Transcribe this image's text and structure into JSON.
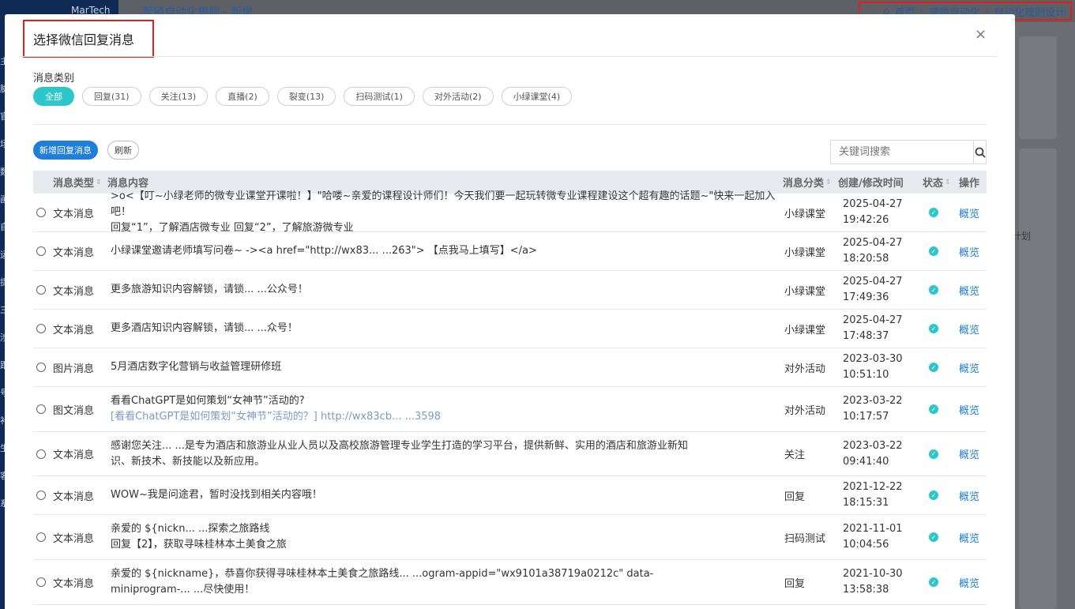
{
  "background": {
    "brand": "MarTech",
    "page_title": "营销自动化规则 - 新增",
    "breadcrumb": [
      "首页",
      "营销自动化",
      "自动化规则设计"
    ],
    "side_text": "计划",
    "left_glyphs": [
      "主",
      "臉",
      "官",
      "场",
      "数",
      "画",
      "自",
      "运",
      "提",
      "三",
      "渉",
      "跟",
      "号",
      "补",
      "生",
      "客",
      "系"
    ]
  },
  "modal": {
    "title": "选择微信回复消息",
    "close_label": "×",
    "category_label": "消息类别",
    "categories": [
      {
        "label": "全部",
        "active": true
      },
      {
        "label": "回复(31)",
        "active": false
      },
      {
        "label": "关注(13)",
        "active": false
      },
      {
        "label": "直播(2)",
        "active": false
      },
      {
        "label": "裂变(13)",
        "active": false
      },
      {
        "label": "扫码测试(1)",
        "active": false
      },
      {
        "label": "对外活动(2)",
        "active": false
      },
      {
        "label": "小绿课堂(4)",
        "active": false
      }
    ],
    "toolbar": {
      "add_label": "新增回复消息",
      "refresh_label": "刷新"
    },
    "search": {
      "placeholder": "关键词搜索",
      "value": ""
    },
    "table": {
      "headers": {
        "type": "消息类型",
        "content": "消息内容",
        "category": "消息分类",
        "time": "创建/修改时间",
        "status": "状态",
        "op": "操作"
      },
      "rows": [
        {
          "type": "文本消息",
          "line1": ">o<【叮~小绿老师的微专业课堂开课啦！】\"哈喽~亲爱的课程设计师们！今天我们要一起玩转微专业课程建设这个超有趣的话题~\"快来一起加入吧！",
          "line2": "回复“1”，了解酒店微专业 回复“2”，了解旅游微专业",
          "line2_link": false,
          "category": "小绿课堂",
          "date": "2025-04-27",
          "time": "19:42:26",
          "op": "概览"
        },
        {
          "type": "文本消息",
          "line1": "小绿课堂邀请老师填写问卷~ -><a href=\"http://wx83... ...263\"> 【点我马上填写】</a>",
          "line2": "",
          "line2_link": false,
          "category": "小绿课堂",
          "date": "2025-04-27",
          "time": "18:20:58",
          "op": "概览"
        },
        {
          "type": "文本消息",
          "line1": "更多旅游知识内容解锁，请锁... ...公众号！",
          "line2": "",
          "line2_link": false,
          "category": "小绿课堂",
          "date": "2025-04-27",
          "time": "17:49:36",
          "op": "概览"
        },
        {
          "type": "文本消息",
          "line1": "更多酒店知识内容解锁，请锁... ...众号！",
          "line2": "",
          "line2_link": false,
          "category": "小绿课堂",
          "date": "2025-04-27",
          "time": "17:48:37",
          "op": "概览"
        },
        {
          "type": "图片消息",
          "line1": "5月酒店数字化营销与收益管理研修班",
          "line2": "",
          "line2_link": false,
          "category": "对外活动",
          "date": "2023-03-30",
          "time": "10:51:10",
          "op": "概览"
        },
        {
          "type": "图文消息",
          "line1": "看看ChatGPT是如何策划“女神节”活动的?",
          "line2": "[看看ChatGPT是如何策划“女神节”活动的？] http://wx83cb... ...3598",
          "line2_link": true,
          "category": "对外活动",
          "date": "2023-03-22",
          "time": "10:17:57",
          "op": "概览"
        },
        {
          "type": "文本消息",
          "line1": "感谢您关注... ...是专为酒店和旅游业从业人员以及高校旅游管理专业学生打造的学习平台，提供新鲜、实用的酒店和旅游业新知",
          "line2": "识、新技术、新技能以及新应用。",
          "line2_link": false,
          "category": "关注",
          "date": "2023-03-22",
          "time": "09:41:40",
          "op": "概览"
        },
        {
          "type": "文本消息",
          "line1": "WOW~我是问途君，暂时没找到相关内容哦！",
          "line2": "",
          "line2_link": false,
          "category": "回复",
          "date": "2021-12-22",
          "time": "18:15:31",
          "op": "概览"
        },
        {
          "type": "文本消息",
          "line1": "亲爱的 ${nickn... ...探索之旅路线",
          "line2": "回复【2】，获取寻味桂林本土美食之旅",
          "line2_link": false,
          "category": "扫码测试",
          "date": "2021-11-01",
          "time": "10:04:56",
          "op": "概览"
        },
        {
          "type": "文本消息",
          "line1": "亲爱的 ${nickname}，恭喜你获得寻味桂林本土美食之旅路线... ...ogram-appid=\"wx9101a38719a0212c\" data-",
          "line2": "miniprogram-... ...尽快使用！",
          "line2_link": false,
          "category": "回复",
          "date": "2021-10-30",
          "time": "13:58:38",
          "op": "概览"
        }
      ]
    }
  },
  "colors": {
    "accent": "#2ec7c9",
    "primary": "#1e7ed8",
    "highlight_border": "#e02020"
  }
}
